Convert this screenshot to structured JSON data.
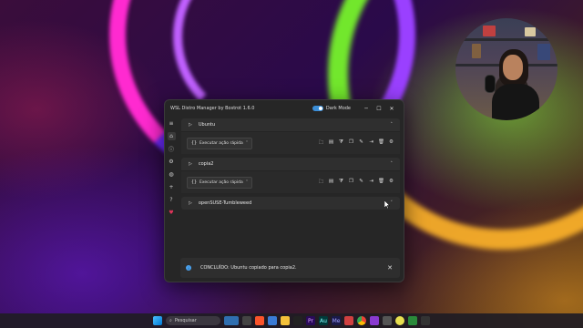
{
  "window": {
    "title": "WSL Distro Manager by Bostrot 1.6.0",
    "dark_mode_label": "Dark Mode",
    "minimize": "─",
    "maximize": "☐",
    "close": "✕"
  },
  "sidebar": {
    "items": [
      {
        "icon": "menu-icon",
        "glyph": "≡"
      },
      {
        "icon": "home-icon",
        "glyph": "⌂"
      },
      {
        "icon": "info-icon",
        "glyph": "ⓘ"
      },
      {
        "icon": "settings-icon",
        "glyph": "⚙"
      },
      {
        "icon": "download-icon",
        "glyph": "◍"
      },
      {
        "icon": "add-icon",
        "glyph": "+"
      },
      {
        "icon": "help-icon",
        "glyph": "?"
      },
      {
        "icon": "heart-icon",
        "glyph": "♥"
      }
    ]
  },
  "distros": [
    {
      "name": "Ubuntu",
      "action_label": "Executar ação rápida",
      "expanded": true
    },
    {
      "name": "copia2",
      "action_label": "Executar ação rápida",
      "expanded": true
    },
    {
      "name": "openSUSE-Tumbleweed",
      "expanded": false
    }
  ],
  "tools": [
    {
      "icon": "folder-open-icon",
      "glyph": "🗀"
    },
    {
      "icon": "terminal-icon",
      "glyph": "▤"
    },
    {
      "icon": "vscode-icon",
      "glyph": "⧩"
    },
    {
      "icon": "copy-icon",
      "glyph": "❐"
    },
    {
      "icon": "rename-icon",
      "glyph": "✎"
    },
    {
      "icon": "stop-icon",
      "glyph": "⇥"
    },
    {
      "icon": "delete-icon",
      "glyph": "🗑"
    },
    {
      "icon": "gear-icon",
      "glyph": "⚙"
    }
  ],
  "notification": {
    "message": "CONCLUÍDO: Ubuntu copiado para copia2.",
    "info_glyph": "i",
    "close": "✕"
  },
  "taskbar": {
    "search_placeholder": "Pesquisar"
  }
}
